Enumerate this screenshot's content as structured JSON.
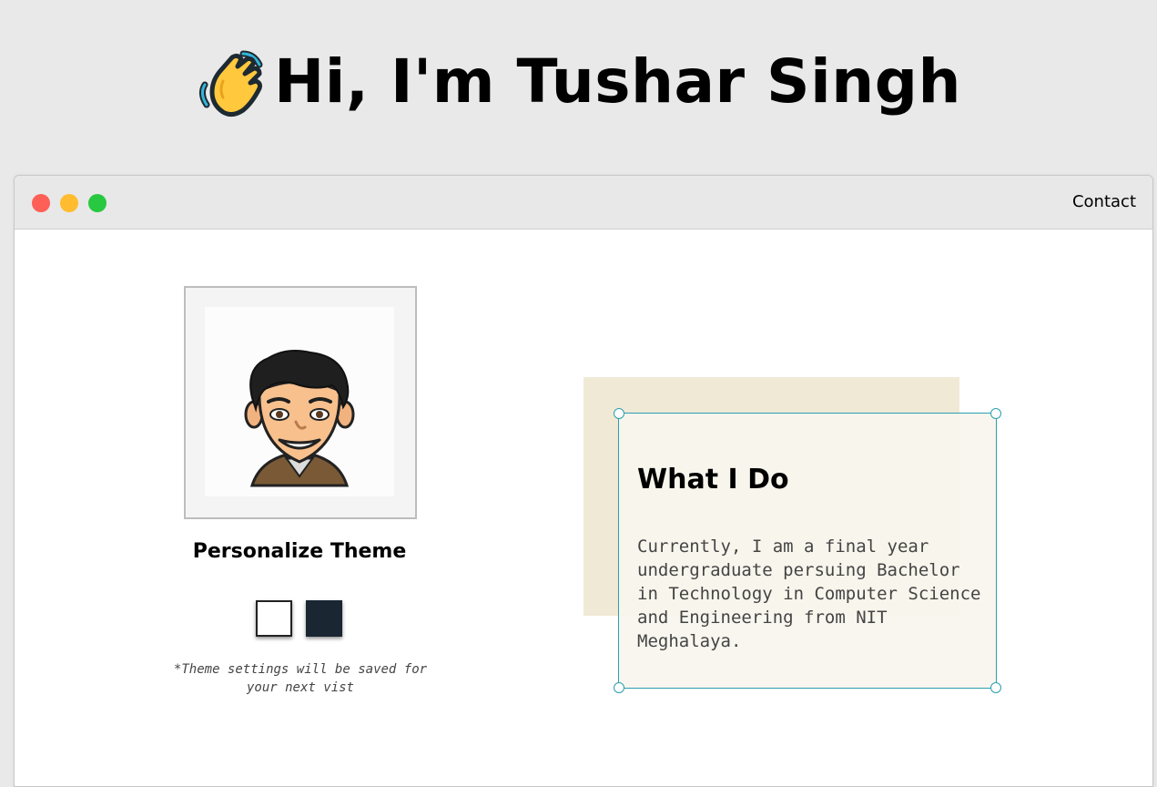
{
  "hero": {
    "title": "Hi, I'm Tushar Singh",
    "icon": "waving-hand-icon"
  },
  "window": {
    "controls": [
      "close",
      "minimize",
      "maximize"
    ],
    "control_colors": [
      "#fe5f57",
      "#febc2e",
      "#28c840"
    ],
    "nav_link": "Contact"
  },
  "profile": {
    "avatar_icon": "bitmoji-avatar",
    "theme_title": "Personalize Theme",
    "themes": [
      {
        "name": "light",
        "color": "#ffffff"
      },
      {
        "name": "dark",
        "color": "#1a2632"
      }
    ],
    "theme_note": "*Theme settings will be saved for your next vist"
  },
  "about": {
    "title": "What I Do",
    "text": "Currently, I am a final year undergraduate persuing Bachelor in Technology in Computer Science and Engineering from NIT Meghalaya."
  },
  "colors": {
    "page_background": "#e9e9e9",
    "card_border": "#2a9fb0",
    "card_backdrop": "#f0e9d6"
  }
}
